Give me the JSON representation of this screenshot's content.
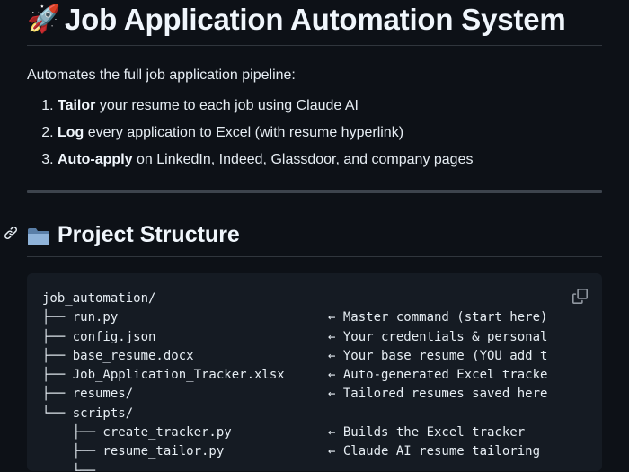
{
  "header": {
    "title_icon": "rocket-emoji",
    "title": "Job Application Automation System"
  },
  "intro": "Automates the full job application pipeline:",
  "steps": [
    {
      "num": "1.",
      "bold": "Tailor",
      "rest": " your resume to each job using Claude AI"
    },
    {
      "num": "2.",
      "bold": "Log",
      "rest": " every application to Excel (with resume hyperlink)"
    },
    {
      "num": "3.",
      "bold": "Auto-apply",
      "rest": " on LinkedIn, Indeed, Glassdoor, and company pages"
    }
  ],
  "section": {
    "icon": "folder-icon",
    "anchor_icon": "link-icon",
    "title": "Project Structure"
  },
  "code": {
    "copy_icon": "copy-icon",
    "lines": [
      {
        "left": "job_automation/",
        "right": ""
      },
      {
        "left": "├── run.py",
        "right": "← Master command (start here)"
      },
      {
        "left": "├── config.json",
        "right": "← Your credentials & personal"
      },
      {
        "left": "├── base_resume.docx",
        "right": "← Your base resume (YOU add t"
      },
      {
        "left": "├── Job_Application_Tracker.xlsx",
        "right": "← Auto-generated Excel tracke"
      },
      {
        "left": "├── resumes/",
        "right": "← Tailored resumes saved here"
      },
      {
        "left": "└── scripts/",
        "right": ""
      },
      {
        "left": "    ├── create_tracker.py",
        "right": "← Builds the Excel tracker"
      },
      {
        "left": "    ├── resume_tailor.py",
        "right": "← Claude AI resume tailoring"
      },
      {
        "left": "    ├──",
        "right": ""
      }
    ]
  },
  "colors": {
    "background": "#0d1117",
    "code_background": "#151b23",
    "text": "#e6edf3",
    "rule": "#30363d"
  }
}
